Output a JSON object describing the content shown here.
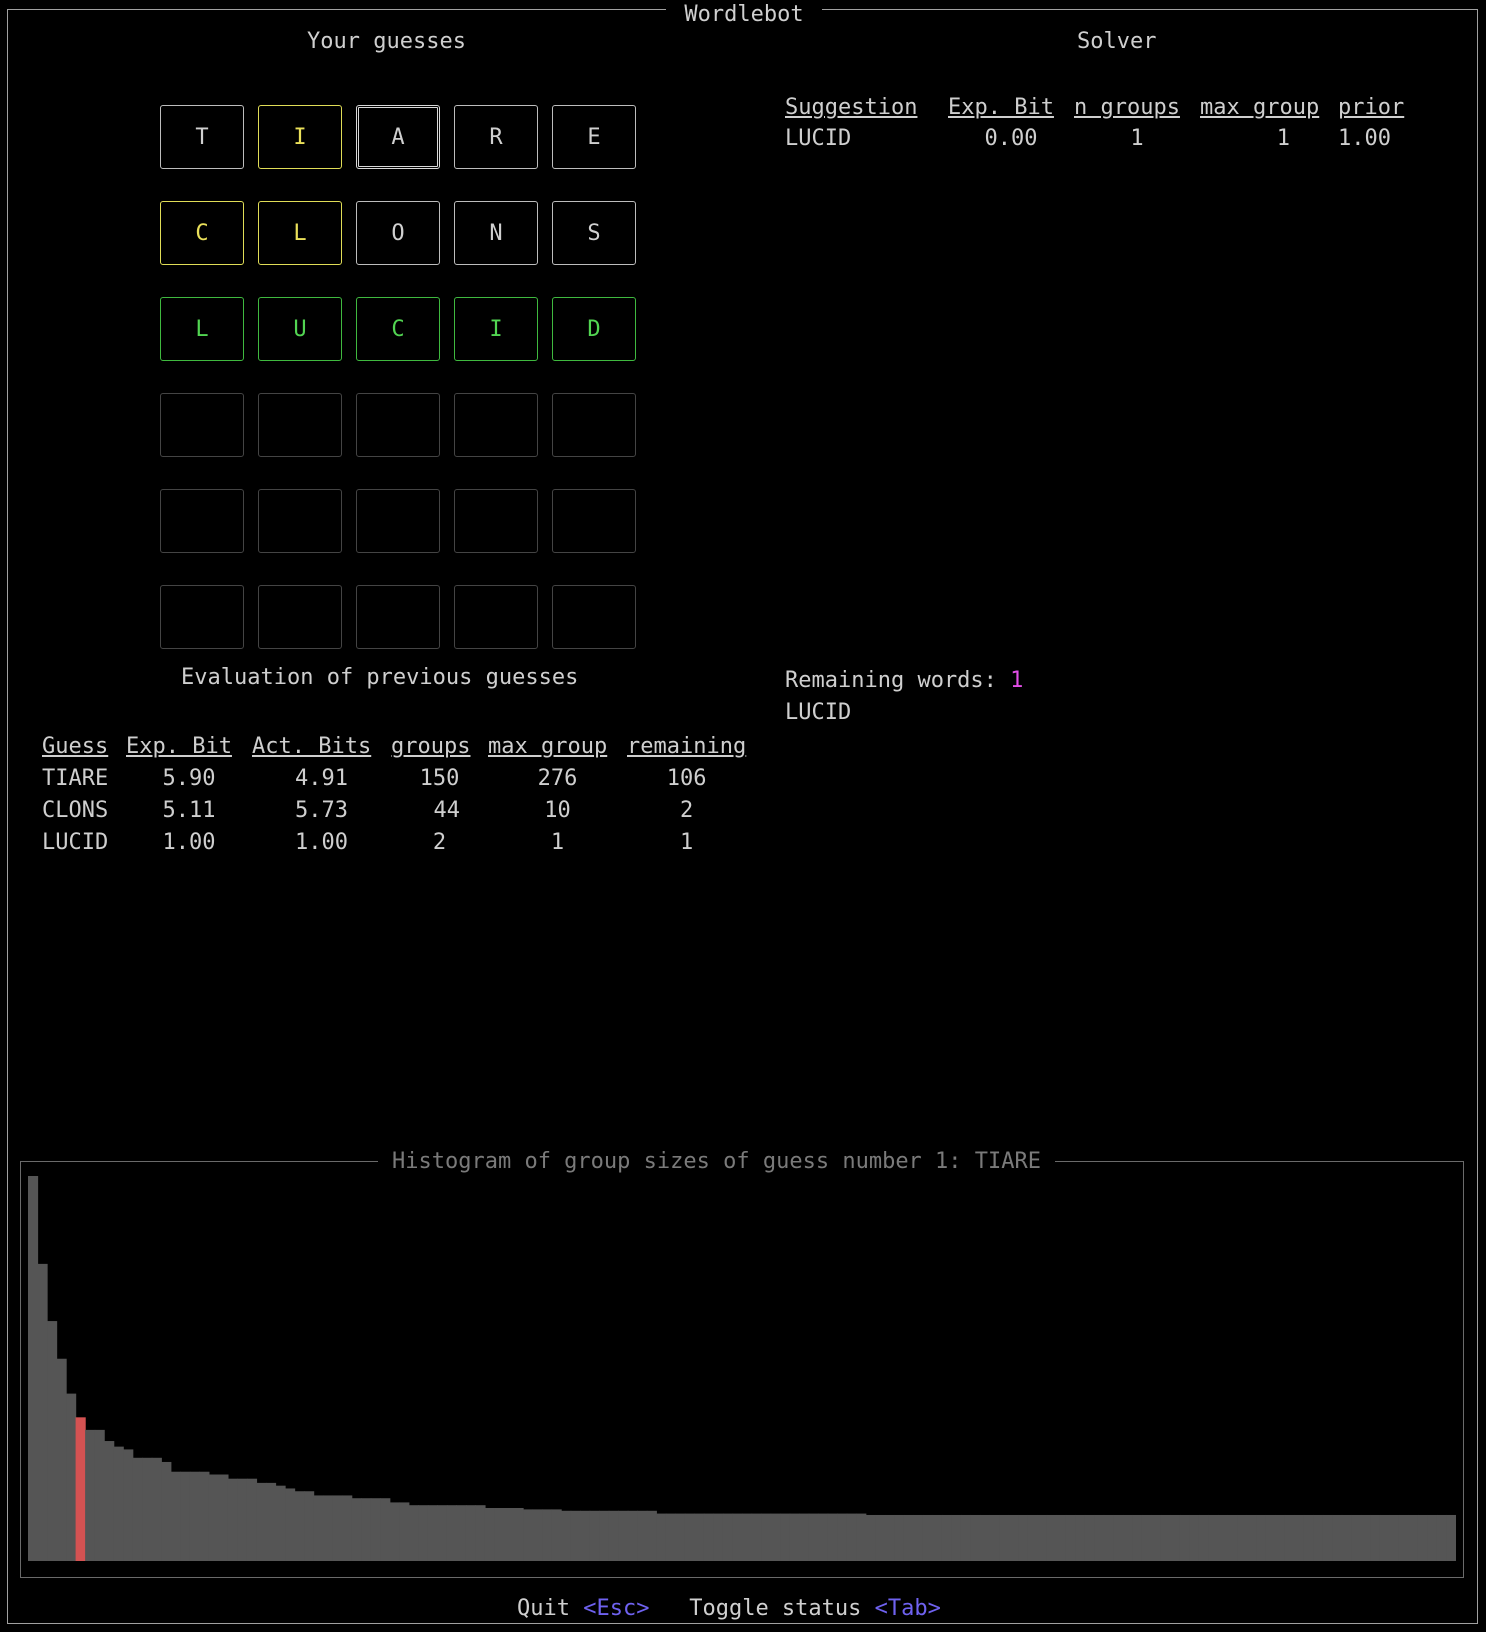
{
  "app_title": "Wordlebot",
  "guesses_panel": {
    "title": "Your guesses",
    "rows": [
      {
        "word": "TIARE",
        "tiles": [
          {
            "letter": "T",
            "state": "absent"
          },
          {
            "letter": "I",
            "state": "present"
          },
          {
            "letter": "A",
            "state": "absent"
          },
          {
            "letter": "R",
            "state": "absent"
          },
          {
            "letter": "E",
            "state": "absent"
          }
        ]
      },
      {
        "word": "CLONS",
        "tiles": [
          {
            "letter": "C",
            "state": "present"
          },
          {
            "letter": "L",
            "state": "present"
          },
          {
            "letter": "O",
            "state": "absent"
          },
          {
            "letter": "N",
            "state": "absent"
          },
          {
            "letter": "S",
            "state": "absent"
          }
        ]
      },
      {
        "word": "LUCID",
        "tiles": [
          {
            "letter": "L",
            "state": "correct"
          },
          {
            "letter": "U",
            "state": "correct"
          },
          {
            "letter": "C",
            "state": "correct"
          },
          {
            "letter": "I",
            "state": "correct"
          },
          {
            "letter": "D",
            "state": "correct"
          }
        ]
      },
      {
        "word": "",
        "tiles": []
      },
      {
        "word": "",
        "tiles": []
      },
      {
        "word": "",
        "tiles": []
      }
    ]
  },
  "solver": {
    "title": "Solver",
    "headers": [
      "Suggestion",
      "Exp. Bit",
      "n groups",
      "max group",
      "prior"
    ],
    "rows": [
      [
        "LUCID",
        "0.00",
        "1",
        "1",
        "1.00"
      ]
    ]
  },
  "evaluation": {
    "title": "Evaluation of previous guesses",
    "headers": [
      "Guess",
      "Exp. Bit",
      "Act. Bits",
      "groups",
      "max group",
      "remaining"
    ],
    "rows": [
      [
        "TIARE",
        "5.90",
        "4.91",
        "150",
        "276",
        "106"
      ],
      [
        "CLONS",
        "5.11",
        "5.73",
        "44",
        "10",
        "2"
      ],
      [
        "LUCID",
        "1.00",
        "1.00",
        "2",
        "1",
        "1"
      ]
    ]
  },
  "remaining": {
    "label": "Remaining words:",
    "count": "1",
    "words": [
      "LUCID"
    ]
  },
  "histogram": {
    "title": "Histogram of group sizes of guess number 1: TIARE",
    "highlight_index": 5,
    "colors": {
      "bar": "#555555",
      "highlight": "#d45252"
    },
    "chart_data": {
      "type": "bar",
      "values": [
        276,
        213,
        172,
        145,
        120,
        103,
        94,
        94,
        86,
        82,
        80,
        74,
        74,
        74,
        71,
        64,
        64,
        64,
        64,
        62,
        62,
        59,
        59,
        59,
        56,
        56,
        54,
        52,
        50,
        50,
        47,
        47,
        47,
        47,
        45,
        45,
        45,
        45,
        42,
        42,
        40,
        40,
        40,
        40,
        40,
        40,
        40,
        40,
        38,
        38,
        38,
        38,
        37,
        37,
        37,
        37,
        36,
        36,
        36,
        36,
        36,
        36,
        36,
        36,
        36,
        36,
        34,
        34,
        34,
        34,
        34,
        34,
        34,
        34,
        34,
        34,
        34,
        34,
        34,
        34,
        34,
        34,
        34,
        34,
        34,
        34,
        34,
        34,
        33,
        33,
        33,
        33,
        33,
        33,
        33,
        33,
        33,
        33,
        33,
        33,
        33,
        33,
        33,
        33,
        33,
        33,
        33,
        33,
        33,
        33,
        33,
        33,
        33,
        33,
        33,
        33,
        33,
        33,
        33,
        33,
        33,
        33,
        33,
        33,
        33,
        33,
        33,
        33,
        33,
        33,
        33,
        33,
        33,
        33,
        33,
        33,
        33,
        33,
        33,
        33,
        33,
        33,
        33,
        33,
        33,
        33,
        33,
        33,
        33,
        33
      ],
      "scale_note": ""
    }
  },
  "footer": {
    "quit_label": "Quit",
    "quit_key": "<Esc>",
    "toggle_label": "Toggle status",
    "toggle_key": "<Tab>"
  }
}
